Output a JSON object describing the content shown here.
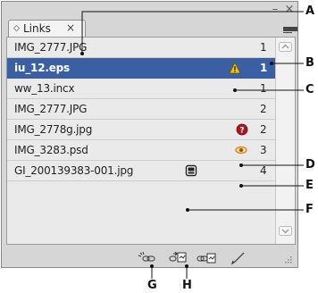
{
  "panel": {
    "tab": {
      "label": "Links",
      "close_glyph": "×"
    },
    "controls": {
      "minimize_glyph": "–",
      "close_glyph": "×"
    }
  },
  "links": [
    {
      "name": "IMG_2777.JPG",
      "page": "1",
      "status": "none",
      "selected": false
    },
    {
      "name": "iu_12.eps",
      "page": "1",
      "status": "modified-warning-icon",
      "selected": true
    },
    {
      "name": "ww_13.incx",
      "page": "1",
      "status": "none",
      "selected": false
    },
    {
      "name": "IMG_2777.JPG",
      "page": "2",
      "status": "none",
      "selected": false
    },
    {
      "name": "IMG_2778g.jpg",
      "page": "2",
      "status": "missing-link-icon",
      "selected": false
    },
    {
      "name": "IMG_3283.psd",
      "page": "3",
      "status": "layer-override-icon",
      "selected": false
    },
    {
      "name": "GI_200139383-001.jpg",
      "page": "4",
      "status": "embedded-icon",
      "selected": false
    }
  ],
  "toolbar": {
    "buttons": [
      "relink-from-cc-icon",
      "relink-icon",
      "go-to-link-icon",
      "edit-original-icon"
    ]
  },
  "callouts": {
    "A": "A",
    "B": "B",
    "C": "C",
    "D": "D",
    "E": "E",
    "F": "F",
    "G": "G",
    "H": "H"
  },
  "colors": {
    "selection": "#3b5fa3",
    "panel_bg": "#d6d6d6",
    "warning": "#f2c200",
    "missing": "#b0151b",
    "override": "#e07a10"
  }
}
